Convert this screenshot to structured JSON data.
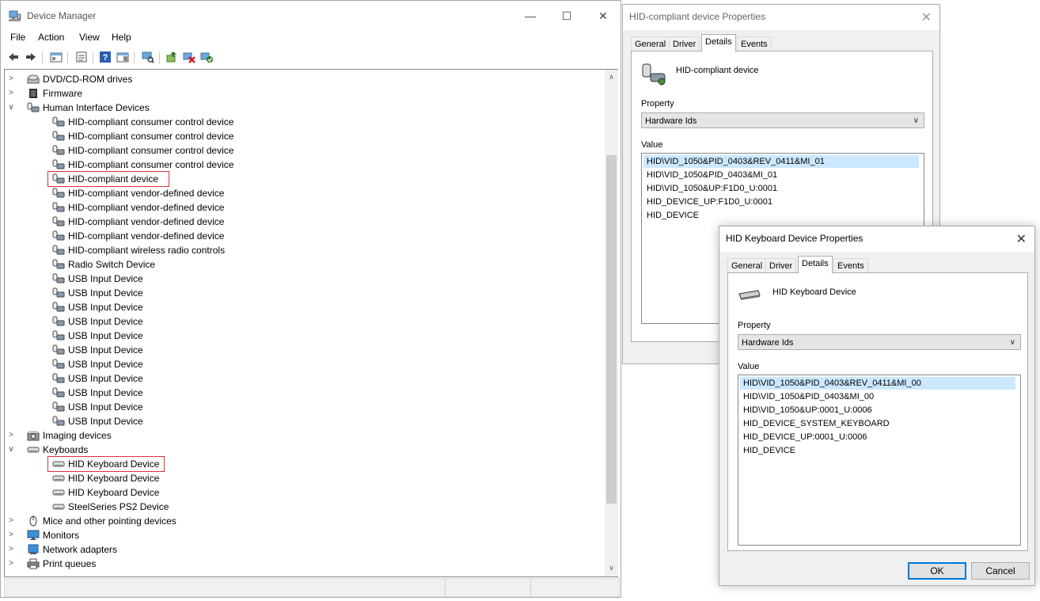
{
  "device_manager": {
    "title": "Device Manager",
    "menu": [
      "File",
      "Action",
      "View",
      "Help"
    ],
    "tree": [
      {
        "indent": 0,
        "expander": "›",
        "icon": "dvd-drive-icon",
        "label": "DVD/CD-ROM drives"
      },
      {
        "indent": 0,
        "expander": "›",
        "icon": "firmware-icon",
        "label": "Firmware"
      },
      {
        "indent": 0,
        "expander": "⌄",
        "icon": "hid-icon",
        "label": "Human Interface Devices"
      },
      {
        "indent": 1,
        "icon": "hid-icon",
        "label": "HID-compliant consumer control device"
      },
      {
        "indent": 1,
        "icon": "hid-icon",
        "label": "HID-compliant consumer control device"
      },
      {
        "indent": 1,
        "icon": "hid-icon",
        "label": "HID-compliant consumer control device"
      },
      {
        "indent": 1,
        "icon": "hid-icon",
        "label": "HID-compliant consumer control device"
      },
      {
        "indent": 1,
        "icon": "hid-icon",
        "label": "HID-compliant device",
        "highlighted": true
      },
      {
        "indent": 1,
        "icon": "hid-icon",
        "label": "HID-compliant vendor-defined device"
      },
      {
        "indent": 1,
        "icon": "hid-icon",
        "label": "HID-compliant vendor-defined device"
      },
      {
        "indent": 1,
        "icon": "hid-icon",
        "label": "HID-compliant vendor-defined device"
      },
      {
        "indent": 1,
        "icon": "hid-icon",
        "label": "HID-compliant vendor-defined device"
      },
      {
        "indent": 1,
        "icon": "hid-icon",
        "label": "HID-compliant wireless radio controls"
      },
      {
        "indent": 1,
        "icon": "hid-icon",
        "label": "Radio Switch Device"
      },
      {
        "indent": 1,
        "icon": "hid-icon",
        "label": "USB Input Device"
      },
      {
        "indent": 1,
        "icon": "hid-icon",
        "label": "USB Input Device"
      },
      {
        "indent": 1,
        "icon": "hid-icon",
        "label": "USB Input Device"
      },
      {
        "indent": 1,
        "icon": "hid-icon",
        "label": "USB Input Device"
      },
      {
        "indent": 1,
        "icon": "hid-icon",
        "label": "USB Input Device"
      },
      {
        "indent": 1,
        "icon": "hid-icon",
        "label": "USB Input Device"
      },
      {
        "indent": 1,
        "icon": "hid-icon",
        "label": "USB Input Device"
      },
      {
        "indent": 1,
        "icon": "hid-icon",
        "label": "USB Input Device"
      },
      {
        "indent": 1,
        "icon": "hid-icon",
        "label": "USB Input Device"
      },
      {
        "indent": 1,
        "icon": "hid-icon",
        "label": "USB Input Device"
      },
      {
        "indent": 1,
        "icon": "hid-icon",
        "label": "USB Input Device"
      },
      {
        "indent": 0,
        "expander": "›",
        "icon": "imaging-icon",
        "label": "Imaging devices"
      },
      {
        "indent": 0,
        "expander": "⌄",
        "icon": "keyboard-icon",
        "label": "Keyboards"
      },
      {
        "indent": 1,
        "icon": "keyboard-icon",
        "label": "HID Keyboard Device",
        "highlighted": true
      },
      {
        "indent": 1,
        "icon": "keyboard-icon",
        "label": "HID Keyboard Device"
      },
      {
        "indent": 1,
        "icon": "keyboard-icon",
        "label": "HID Keyboard Device"
      },
      {
        "indent": 1,
        "icon": "keyboard-icon",
        "label": "SteelSeries PS2 Device"
      },
      {
        "indent": 0,
        "expander": "›",
        "icon": "mouse-icon",
        "label": "Mice and other pointing devices"
      },
      {
        "indent": 0,
        "expander": "›",
        "icon": "monitor-icon",
        "label": "Monitors"
      },
      {
        "indent": 0,
        "expander": "›",
        "icon": "network-adapter-icon",
        "label": "Network adapters"
      },
      {
        "indent": 0,
        "expander": "›",
        "icon": "printer-icon",
        "label": "Print queues"
      }
    ]
  },
  "hid_dialog": {
    "title": "HID-compliant device Properties",
    "tabs": [
      "General",
      "Driver",
      "Details",
      "Events"
    ],
    "active_tab": "Details",
    "device_name": "HID-compliant device",
    "property_label": "Property",
    "property_value": "Hardware Ids",
    "value_label": "Value",
    "values": [
      "HID\\VID_1050&PID_0403&REV_0411&MI_01",
      "HID\\VID_1050&PID_0403&MI_01",
      "HID\\VID_1050&UP:F1D0_U:0001",
      "HID_DEVICE_UP:F1D0_U:0001",
      "HID_DEVICE"
    ]
  },
  "kbd_dialog": {
    "title": "HID Keyboard Device Properties",
    "tabs": [
      "General",
      "Driver",
      "Details",
      "Events"
    ],
    "active_tab": "Details",
    "device_name": "HID Keyboard Device",
    "property_label": "Property",
    "property_value": "Hardware Ids",
    "value_label": "Value",
    "values": [
      "HID\\VID_1050&PID_0403&REV_0411&MI_00",
      "HID\\VID_1050&PID_0403&MI_00",
      "HID\\VID_1050&UP:0001_U:0006",
      "HID_DEVICE_SYSTEM_KEYBOARD",
      "HID_DEVICE_UP:0001_U:0006",
      "HID_DEVICE"
    ],
    "ok_label": "OK",
    "cancel_label": "Cancel"
  },
  "colors": {
    "selection": "#cce8ff",
    "highlight_box": "#e0303a",
    "accent": "#0078d7"
  }
}
